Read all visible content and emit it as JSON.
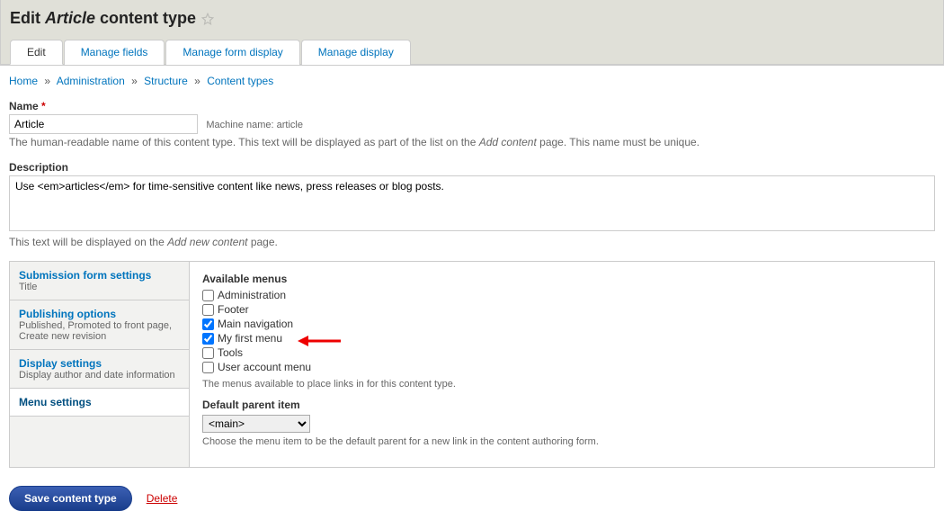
{
  "pageTitle": {
    "prefix": "Edit ",
    "italic": "Article",
    "suffix": " content type"
  },
  "tabs": {
    "edit": "Edit",
    "manageFields": "Manage fields",
    "manageFormDisplay": "Manage form display",
    "manageDisplay": "Manage display"
  },
  "breadcrumb": {
    "home": "Home",
    "admin": "Administration",
    "structure": "Structure",
    "contentTypes": "Content types",
    "sep": "»"
  },
  "nameField": {
    "label": "Name",
    "value": "Article",
    "machineNameLabel": "Machine name: ",
    "machineName": "article",
    "help": "The human-readable name of this content type. This text will be displayed as part of the list on the Add content page. This name must be unique.",
    "helpItalic": "Add content"
  },
  "descField": {
    "label": "Description",
    "value": "Use <em>articles</em> for time-sensitive content like news, press releases or blog posts.",
    "help": "This text will be displayed on the Add new content page.",
    "helpItalic": "Add new content"
  },
  "vtabs": {
    "submission": {
      "title": "Submission form settings",
      "summary": "Title"
    },
    "publishing": {
      "title": "Publishing options",
      "summary": "Published, Promoted to front page, Create new revision"
    },
    "display": {
      "title": "Display settings",
      "summary": "Display author and date information"
    },
    "menu": {
      "title": "Menu settings",
      "summary": ""
    }
  },
  "menuPanel": {
    "availableHeading": "Available menus",
    "menus": [
      {
        "label": "Administration",
        "checked": false
      },
      {
        "label": "Footer",
        "checked": false
      },
      {
        "label": "Main navigation",
        "checked": true
      },
      {
        "label": "My first menu",
        "checked": true
      },
      {
        "label": "Tools",
        "checked": false
      },
      {
        "label": "User account menu",
        "checked": false
      }
    ],
    "availableHelp": "The menus available to place links in for this content type.",
    "parentHeading": "Default parent item",
    "parentValue": "<main>",
    "parentHelp": "Choose the menu item to be the default parent for a new link in the content authoring form."
  },
  "actions": {
    "save": "Save content type",
    "delete": "Delete"
  }
}
